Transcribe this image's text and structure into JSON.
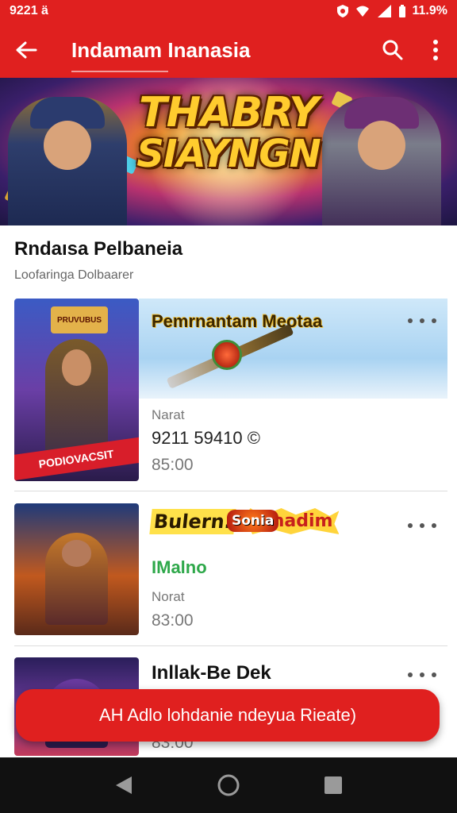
{
  "status_bar": {
    "time": "9221 ä",
    "battery": "11.9%"
  },
  "app_bar": {
    "title": "Indamam Inanasia",
    "back_icon": "arrow-left-icon",
    "search_icon": "search-icon",
    "menu_icon": "more-vert-icon"
  },
  "banner": {
    "logo_line1": "THABRY",
    "logo_line2": "SIAYNGN"
  },
  "section": {
    "heading": "Rndaısa Pelbaneia",
    "subheading": "Loofaringa Dolbaarer"
  },
  "cards": [
    {
      "thumb_badge": "PODIOVACSIT",
      "thumb_banner": "PRUVUBUS",
      "banner_title": "Pemrnantam Meotaa",
      "label": "Narat",
      "value": "9211 59410 ©",
      "price": "85:00"
    },
    {
      "badge1": "Bulern.",
      "badge2": "Yenadim",
      "badge3": "Sonia",
      "status": "IMalno",
      "label": "Norat",
      "price": "83:00"
    },
    {
      "title": "Inllak-Be Dek",
      "price": "83:00"
    }
  ],
  "fab": {
    "label": "AH Adlo lohdanie ndeyua Rieate)"
  },
  "colors": {
    "primary": "#e0201f",
    "accent_green": "#2ea84a"
  }
}
